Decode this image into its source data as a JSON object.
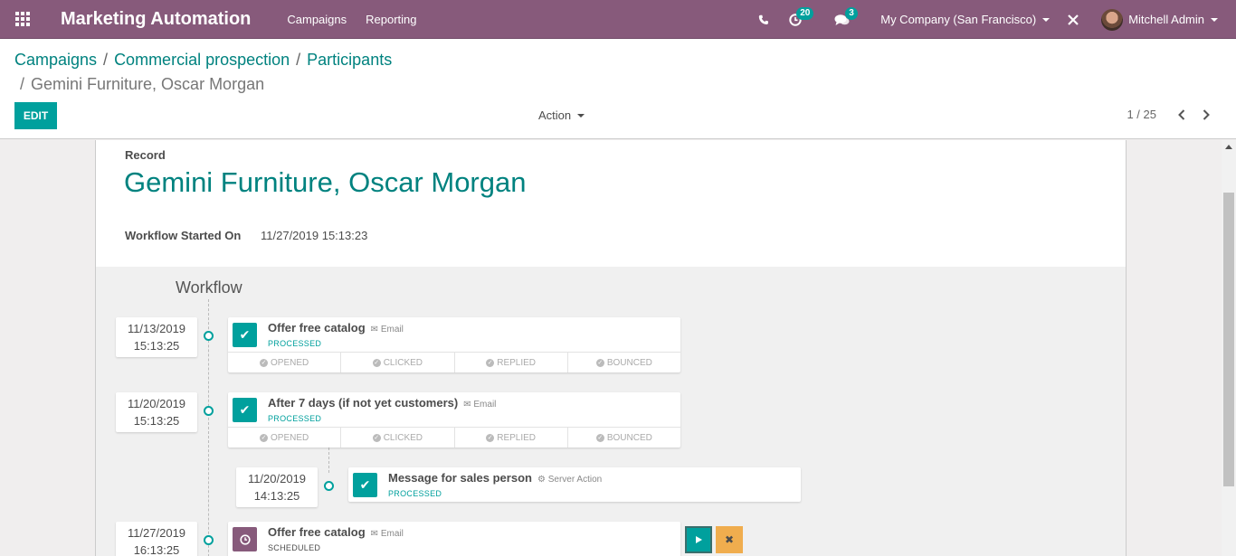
{
  "navbar": {
    "app_title": "Marketing Automation",
    "menu": [
      "Campaigns",
      "Reporting"
    ],
    "activity_count": "20",
    "message_count": "3",
    "company": "My Company (San Francisco)",
    "user": "Mitchell Admin",
    "icons": [
      "apps-grid-icon",
      "phone-icon",
      "clock-icon",
      "chat-icon",
      "debug-tools-icon"
    ],
    "bg_color": "#875a7b"
  },
  "breadcrumb": {
    "items": [
      "Campaigns",
      "Commercial prospection",
      "Participants"
    ],
    "current": "Gemini Furniture, Oscar Morgan"
  },
  "control": {
    "edit_label": "EDIT",
    "action_label": "Action",
    "pager": "1 / 25"
  },
  "record": {
    "label": "Record",
    "title": "Gemini Furniture, Oscar Morgan",
    "started_label": "Workflow Started On",
    "started_value": "11/27/2019 15:13:23"
  },
  "workflow": {
    "title": "Workflow",
    "activities": [
      {
        "date": "11/13/2019",
        "time": "15:13:25",
        "name": "Offer free catalog",
        "type": "Email",
        "state": "PROCESSED",
        "stats": [
          "OPENED",
          "CLICKED",
          "REPLIED",
          "BOUNCED"
        ]
      },
      {
        "date": "11/20/2019",
        "time": "15:13:25",
        "name": "After 7 days (if not yet customers)",
        "type": "Email",
        "state": "PROCESSED",
        "stats": [
          "OPENED",
          "CLICKED",
          "REPLIED",
          "BOUNCED"
        ]
      },
      {
        "date": "11/20/2019",
        "time": "14:13:25",
        "name": "Message for sales person",
        "type": "Server Action",
        "state": "PROCESSED"
      },
      {
        "date": "11/27/2019",
        "time": "16:13:25",
        "name": "Offer free catalog",
        "type": "Email",
        "state": "SCHEDULED"
      }
    ]
  },
  "colors": {
    "accent": "#00a09d",
    "link": "#00827f",
    "brand": "#875a7b",
    "warning": "#f0ad4e"
  }
}
